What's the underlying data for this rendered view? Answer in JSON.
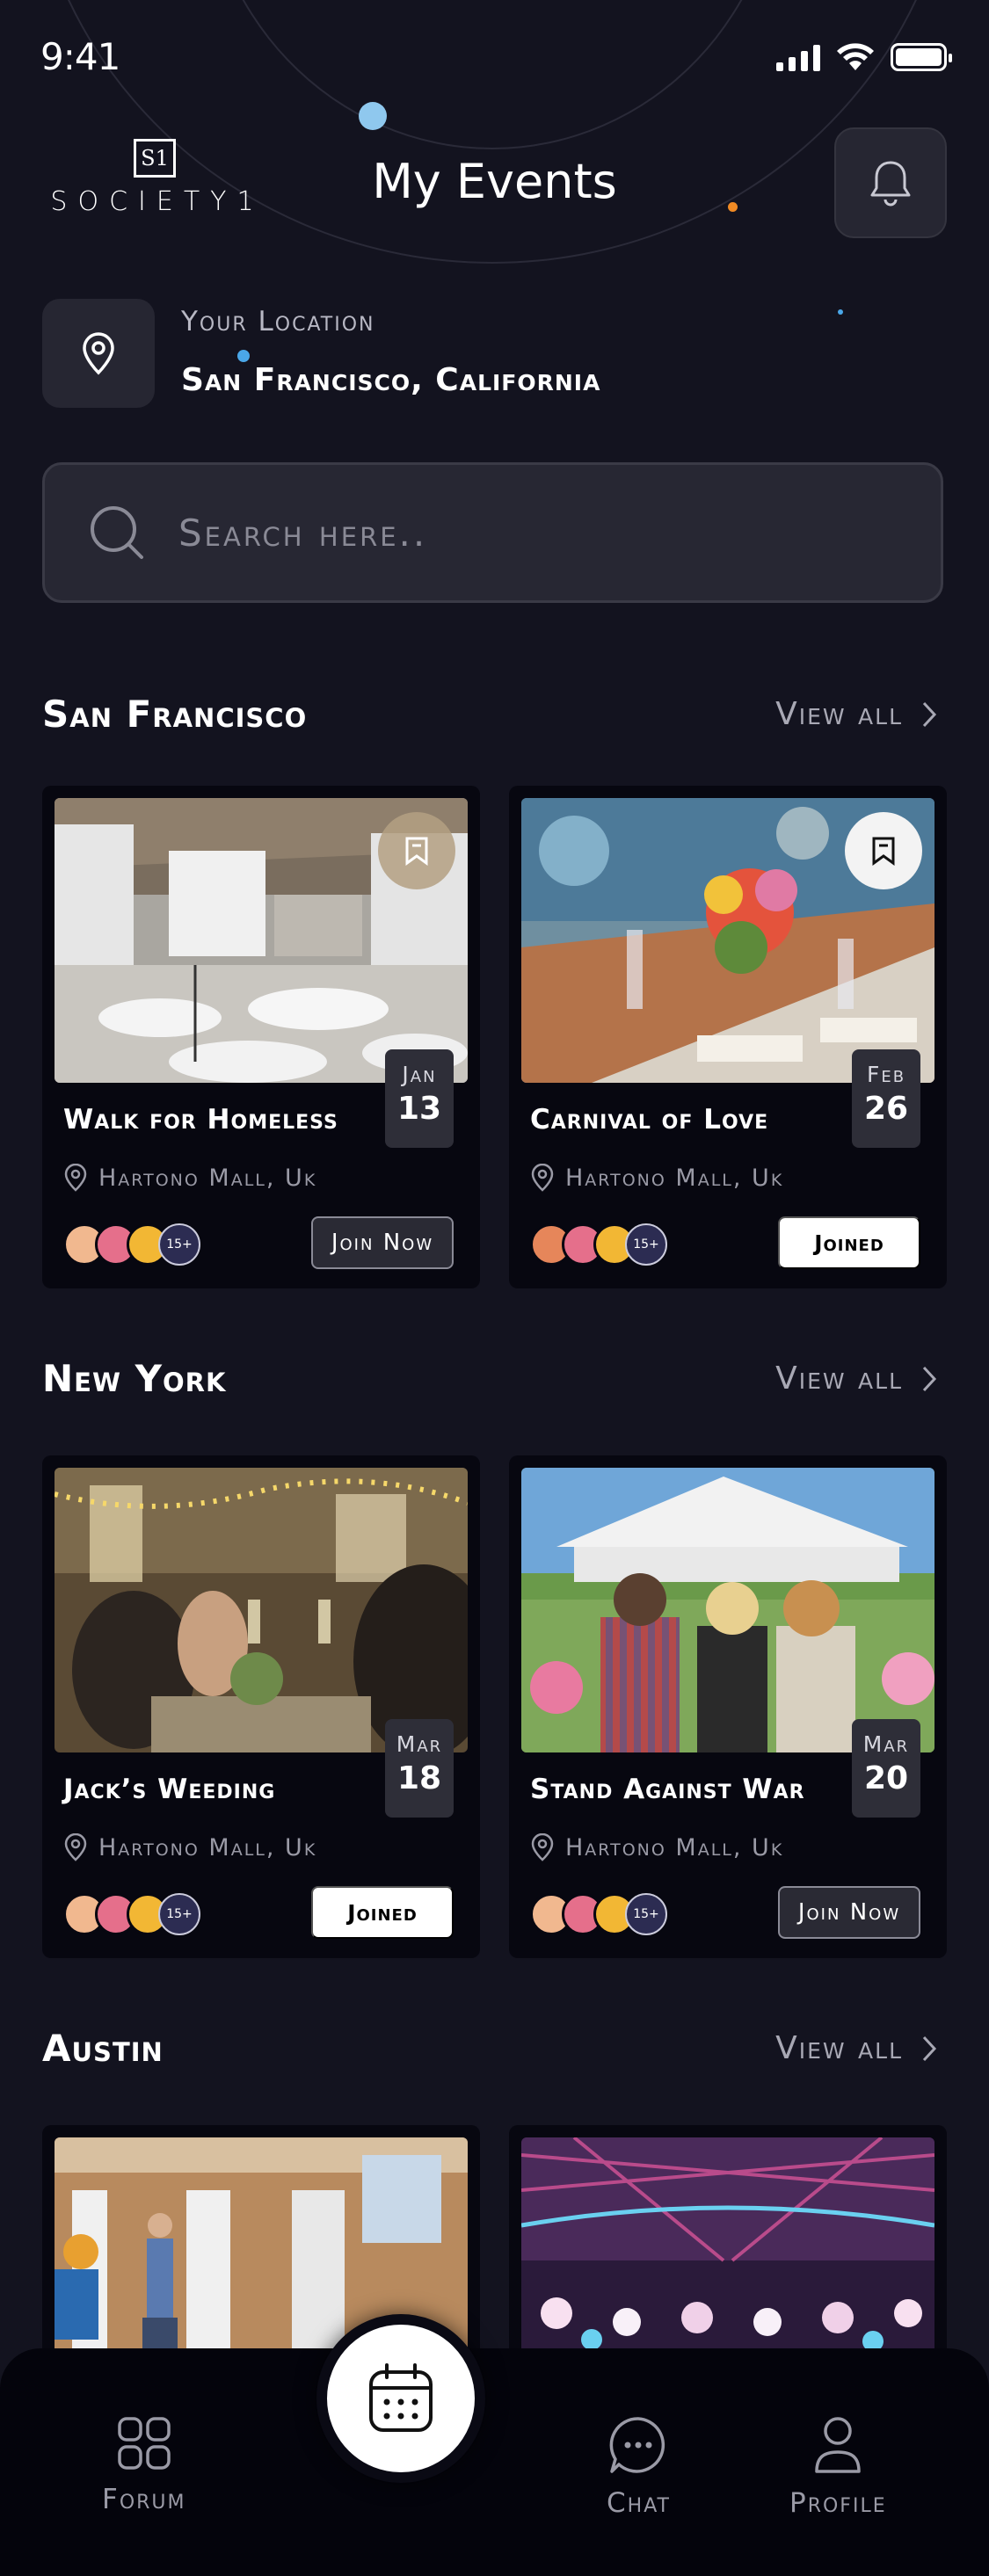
{
  "status_bar": {
    "time": "9:41"
  },
  "header": {
    "logo_mark": "S1",
    "logo_text": "SOCIETY1",
    "title": "My Events"
  },
  "location": {
    "label": "Your Location",
    "value": "San Francisco, California"
  },
  "search": {
    "placeholder": "Search here.."
  },
  "view_all_label": "View all",
  "sections": [
    {
      "title": "San Francisco",
      "events": [
        {
          "title": "Walk for Homeless",
          "month": "Jan",
          "day": "13",
          "location": "Hartono Mall, Uk",
          "attendees_more": "15+",
          "button": "Join Now",
          "joined": false
        },
        {
          "title": "Carnival of Love",
          "month": "Feb",
          "day": "26",
          "location": "Hartono Mall, Uk",
          "attendees_more": "15+",
          "button": "Joined",
          "joined": true
        }
      ]
    },
    {
      "title": "New York",
      "events": [
        {
          "title": "Jack’s Weeding",
          "month": "Mar",
          "day": "18",
          "location": "Hartono Mall, Uk",
          "attendees_more": "15+",
          "button": "Joined",
          "joined": true
        },
        {
          "title": "Stand Against War",
          "month": "Mar",
          "day": "20",
          "location": "Hartono Mall, Uk",
          "attendees_more": "15+",
          "button": "Join Now",
          "joined": false
        }
      ]
    },
    {
      "title": "Austin",
      "events": []
    }
  ],
  "bottom_nav": {
    "forum": "Forum",
    "chat": "Chat",
    "profile": "Profile",
    "center_icon": "calendar-icon"
  },
  "colors": {
    "background": "#13131f",
    "card": "#070710",
    "accent_orange": "#f08a24",
    "accent_blue": "#8fc8ee"
  }
}
